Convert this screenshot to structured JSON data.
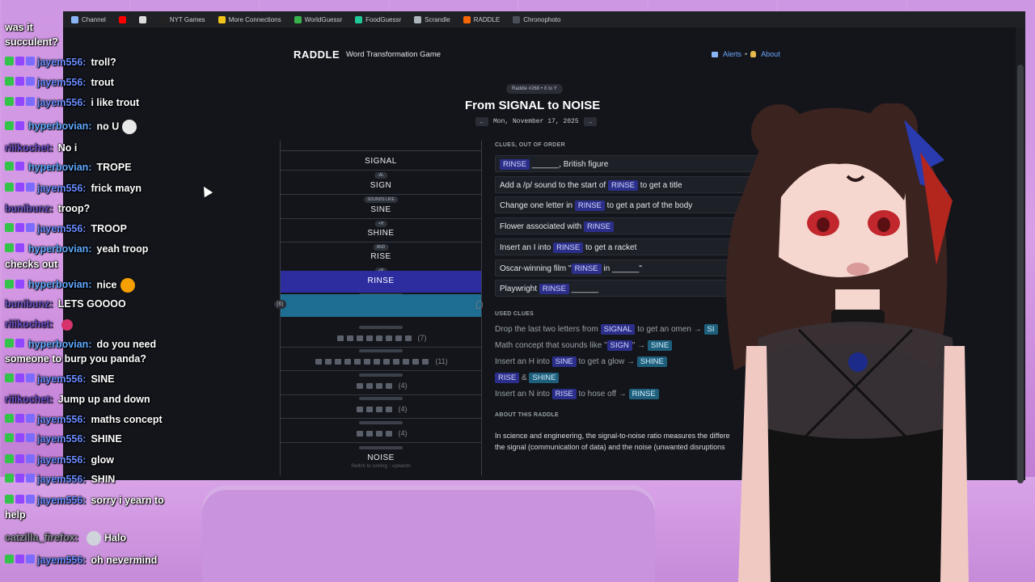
{
  "bookmarks": [
    {
      "label": "Channel",
      "color": "#8ab4f8"
    },
    {
      "label": "",
      "color": "#ff0000"
    },
    {
      "label": "",
      "color": "#dddddd"
    },
    {
      "label": "NYT Games",
      "color": "#222222"
    },
    {
      "label": "More Connections",
      "color": "#f0c419"
    },
    {
      "label": "WorldGuessr",
      "color": "#37b24d"
    },
    {
      "label": "FoodGuessr",
      "color": "#20c997"
    },
    {
      "label": "Scrandle",
      "color": "#adb5bd"
    },
    {
      "label": "RADDLE",
      "color": "#f76707"
    },
    {
      "label": "Chronophoto",
      "color": "#495057"
    }
  ],
  "site": {
    "logo": "RADDLE",
    "tagline": "Word Transformation Game",
    "nav_alerts": "Alerts",
    "nav_sep": "•",
    "nav_about": "About"
  },
  "puzzle": {
    "tag": "Raddle #268 • X to Y",
    "title": "From SIGNAL to NOISE",
    "date": "Mon, November 17, 2025",
    "prev": "←",
    "next": "→"
  },
  "ladder": {
    "words": [
      "SIGNAL",
      "SIGN",
      "SINE",
      "SHINE",
      "RISE",
      "RINSE"
    ],
    "hints": [
      "-AL",
      "SOUNDS LIKE",
      "+H",
      "AND",
      "+N"
    ],
    "blank_count": "(6)",
    "rows": [
      {
        "squares": 8,
        "count": "(7)"
      },
      {
        "squares": 12,
        "count": "(11)"
      },
      {
        "squares": 4,
        "count": "(4)"
      },
      {
        "squares": 4,
        "count": "(4)"
      },
      {
        "squares": 4,
        "count": "(4)"
      }
    ],
    "end_word": "NOISE",
    "switch_text": "Switch to solving ↑ upwards"
  },
  "clues": {
    "heading": "CLUES, OUT OF ORDER",
    "items": [
      {
        "pre": "",
        "tok": "RINSE",
        "post": " ______, British figure"
      },
      {
        "pre": "Add a /p/ sound to the start of ",
        "tok": "RINSE",
        "post": " to get a title"
      },
      {
        "pre": "Change one letter in ",
        "tok": "RINSE",
        "post": " to get a part of the body"
      },
      {
        "pre": "Flower associated with ",
        "tok": "RINSE",
        "post": ""
      },
      {
        "pre": "Insert an I into ",
        "tok": "RINSE",
        "post": " to get a racket"
      },
      {
        "pre": "Oscar-winning film \"",
        "tok": "RINSE",
        "post": " in ______\""
      },
      {
        "pre": "Playwright ",
        "tok": "RINSE",
        "post": " ______"
      }
    ]
  },
  "used": {
    "heading": "USED CLUES",
    "items": [
      {
        "a": "Drop the last two letters from ",
        "t1": "SIGNAL",
        "b": " to get an omen → ",
        "t2": "SI"
      },
      {
        "a": "Math concept that sounds like \"",
        "t1": "SIGN",
        "b": "\" → ",
        "t2": "SINE"
      },
      {
        "a": "Insert an H into ",
        "t1": "SINE",
        "b": " to get a glow → ",
        "t2": "SHINE"
      },
      {
        "a": "",
        "t1": "RISE",
        "b": " & ",
        "t2": "SHINE"
      },
      {
        "a": "Insert an N into ",
        "t1": "RISE",
        "b": " to hose off → ",
        "t2": "RINSE"
      }
    ]
  },
  "about": {
    "heading": "ABOUT THIS RADDLE",
    "line1": "In science and engineering, the signal-to-noise ratio measures the differe",
    "line2": "the signal (communication of data) and the noise (unwanted disruptions"
  },
  "chat": [
    {
      "user": "",
      "text": "was it",
      "ucls": "u-hyper",
      "badges": 0
    },
    {
      "user": "",
      "text": "succulent?",
      "ucls": "",
      "badges": 0
    },
    {
      "user": "jayem556:",
      "text": "troll?",
      "ucls": "u-jayem",
      "badges": 3
    },
    {
      "user": "jayem556:",
      "text": "trout",
      "ucls": "u-jayem",
      "badges": 3
    },
    {
      "user": "jayem556:",
      "text": "i like trout",
      "ucls": "u-jayem",
      "badges": 3
    },
    {
      "user": "hyperbovian:",
      "text": "no U",
      "ucls": "u-hyper",
      "badges": 2
    },
    {
      "user": "riiikochet:",
      "text": "No i",
      "ucls": "u-rili",
      "badges": 0
    },
    {
      "user": "hyperbovian:",
      "text": "TROPE",
      "ucls": "u-hyper",
      "badges": 2
    },
    {
      "user": "jayem556:",
      "text": "frick mayn",
      "ucls": "u-jayem",
      "badges": 3
    },
    {
      "user": "bunibunz:",
      "text": "troop?",
      "ucls": "u-buni",
      "badges": 0
    },
    {
      "user": "jayem556:",
      "text": "TROOP",
      "ucls": "u-jayem",
      "badges": 3
    },
    {
      "user": "hyperbovian:",
      "text": "yeah troop",
      "ucls": "u-hyper",
      "badges": 2
    },
    {
      "user": "",
      "text": "checks out",
      "ucls": "",
      "badges": 0
    },
    {
      "user": "hyperbovian:",
      "text": "nice",
      "ucls": "u-hyper",
      "badges": 2
    },
    {
      "user": "bunibunz:",
      "text": "LETS GOOOO",
      "ucls": "u-buni",
      "badges": 0
    },
    {
      "user": "riiikochet:",
      "text": "",
      "ucls": "u-rili",
      "badges": 0
    },
    {
      "user": "hyperbovian:",
      "text": "do you need",
      "ucls": "u-hyper",
      "badges": 2
    },
    {
      "user": "",
      "text": "someone to burp you panda?",
      "ucls": "",
      "badges": 0
    },
    {
      "user": "jayem556:",
      "text": "SINE",
      "ucls": "u-jayem",
      "badges": 3
    },
    {
      "user": "riiikochet:",
      "text": "Jump up and down",
      "ucls": "u-rili",
      "badges": 0
    },
    {
      "user": "jayem556:",
      "text": "maths concept",
      "ucls": "u-jayem",
      "badges": 3
    },
    {
      "user": "jayem556:",
      "text": "SHINE",
      "ucls": "u-jayem",
      "badges": 3
    },
    {
      "user": "jayem556:",
      "text": "glow",
      "ucls": "u-jayem",
      "badges": 3
    },
    {
      "user": "jayem556:",
      "text": "SHIN",
      "ucls": "u-jayem",
      "badges": 3
    },
    {
      "user": "jayem556:",
      "text": "sorry i yearn to",
      "ucls": "u-jayem",
      "badges": 3
    },
    {
      "user": "",
      "text": "help",
      "ucls": "",
      "badges": 0
    },
    {
      "user": "catzilla_firefox:",
      "text": "Halo",
      "ucls": "u-catz",
      "badges": 0
    },
    {
      "user": "jayem556:",
      "text": "oh nevermind",
      "ucls": "u-jayem",
      "badges": 3
    }
  ]
}
